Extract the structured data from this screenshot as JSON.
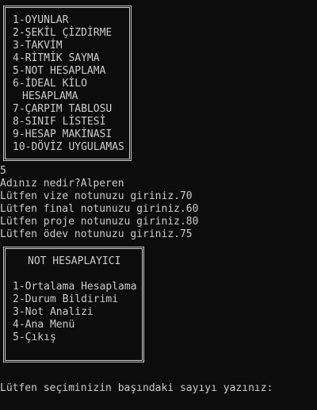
{
  "main_menu": {
    "items": [
      "1-OYUNLAR",
      "2-ŞEKİL ÇİZDİRME",
      "3-TAKVİM",
      "4-RİTMİK SAYMA",
      "5-NOT HESAPLAMA",
      "6-İDEAL KİLO",
      "HESAPLAMA",
      "7-ÇARPIM TABLOSU",
      "8-SINIF LİSTESİ",
      "9-HESAP MAKİNASI",
      "10-DÖVİZ UYGULAMAS"
    ]
  },
  "output": {
    "lines": [
      "5",
      "Adınız nedir?Alperen",
      "Lütfen vize notunuzu giriniz.70",
      "Lütfen final notunuzu giriniz.60",
      "Lütfen proje notunuzu giriniz.80",
      "Lütfen ödev notunuzu giriniz.75"
    ]
  },
  "sub_menu": {
    "title": "NOT HESAPLAYICI",
    "items": [
      "1-Ortalama Hesaplama",
      "2-Durum Bildirimi",
      "3-Not Analizi",
      "4-Ana Menü",
      "5-Çıkış"
    ]
  },
  "prompt": "Lütfen seçiminizin başındaki sayıyı yazınız:"
}
